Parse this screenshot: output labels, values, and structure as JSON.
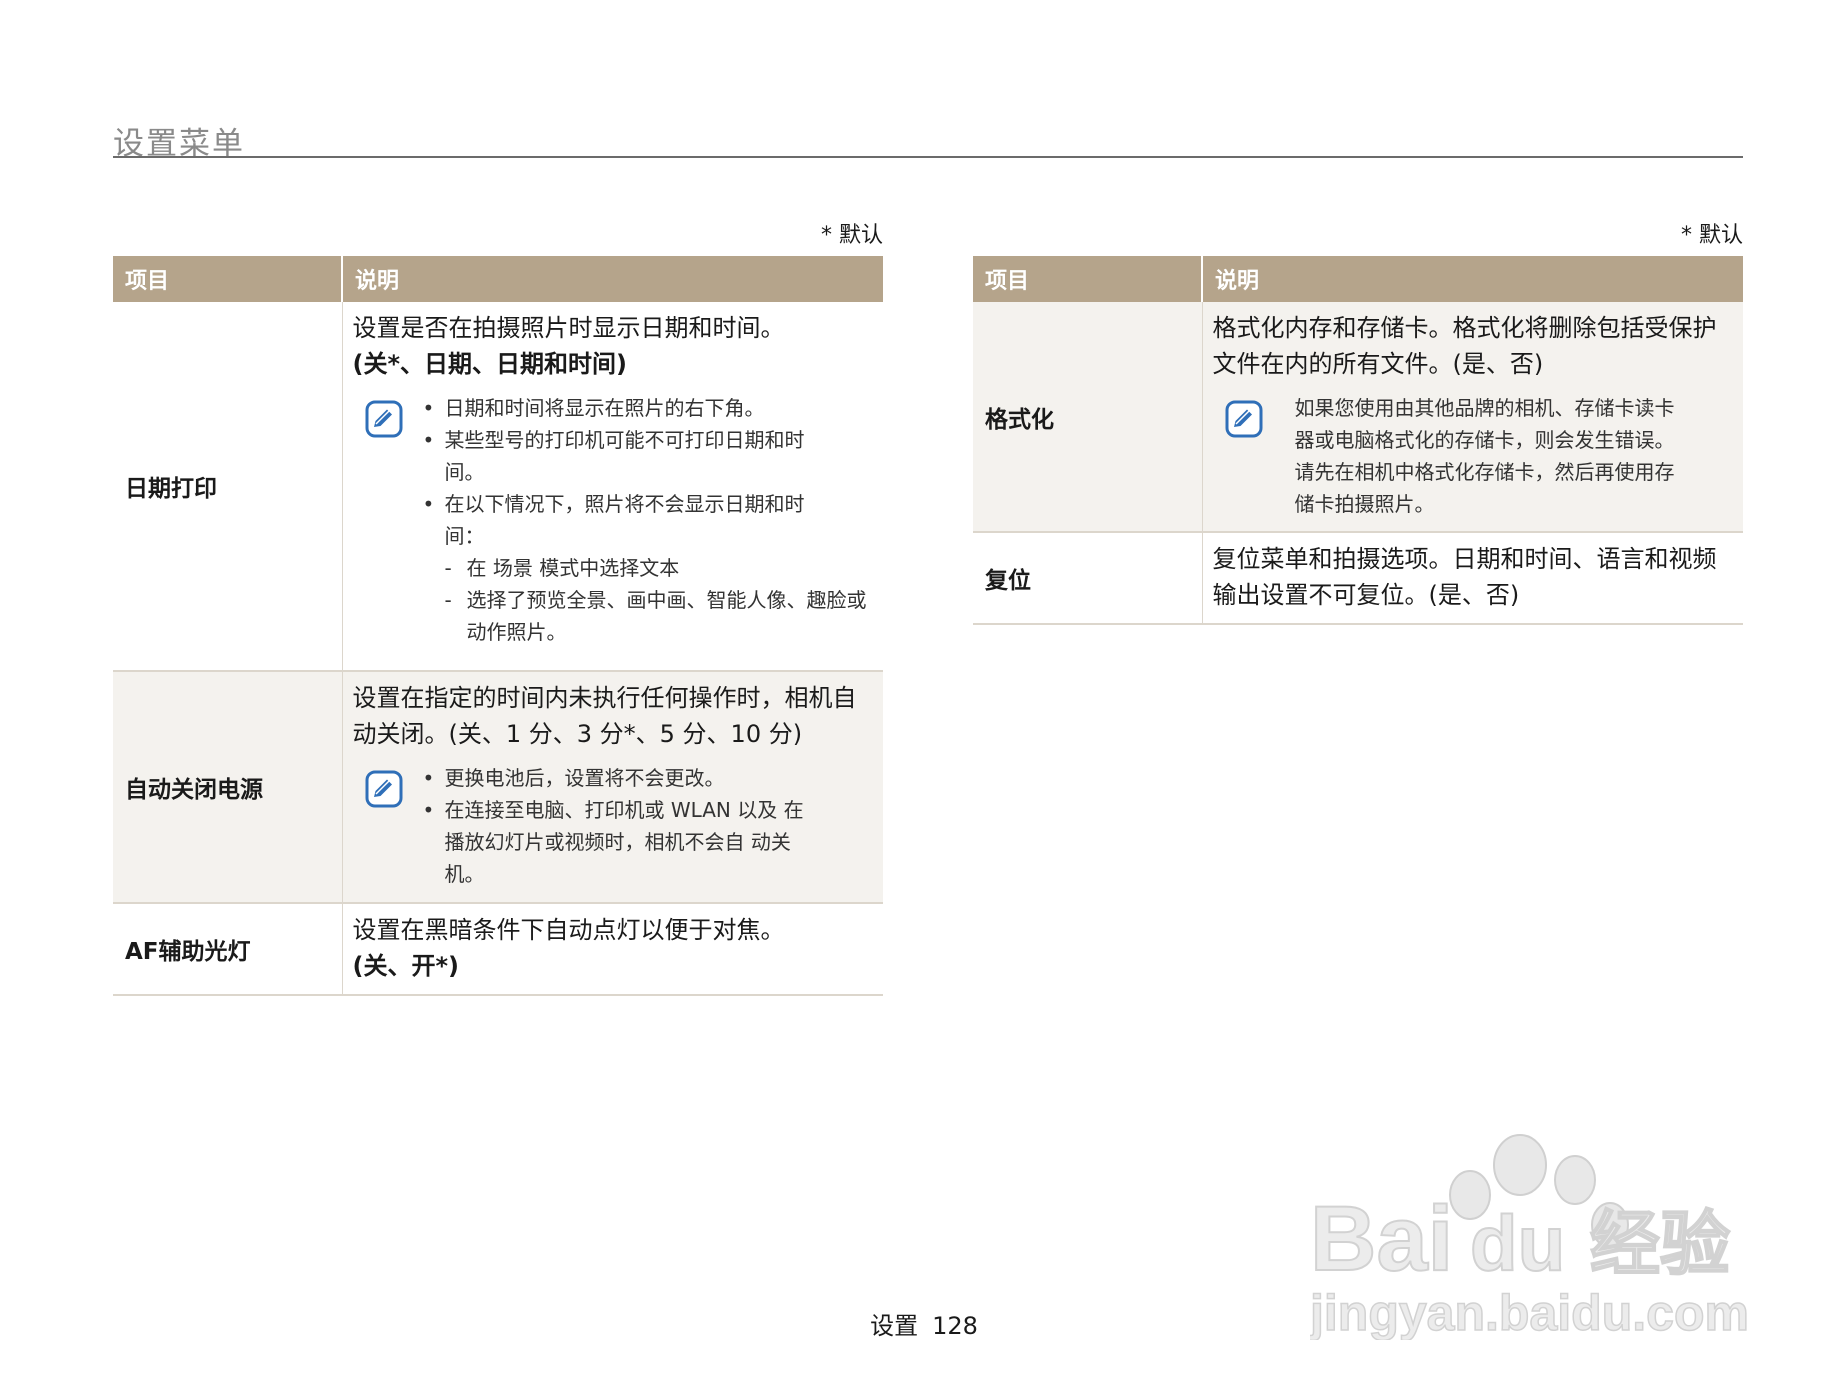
{
  "page_title": "设置菜单",
  "default_note": "* 默认",
  "table_headers": {
    "item": "项目",
    "desc": "说明"
  },
  "left_rows": [
    {
      "item": "日期打印",
      "line1": "设置是否在拍摄照片时显示日期和时间。",
      "line2": "(关*、日期、日期和时间)",
      "note_line1": "日期和时间将显示在照片的右下角。",
      "note_line2": "某些型号的打印机可能不可打印日期和时间。",
      "note_line3": "在以下情况下，照片将不会显示日期和时间：",
      "note_line4": "在 场景 模式中选择文本",
      "note_line5": "选择了预览全景、画中画、智能人像、趣脸或动作照片。"
    },
    {
      "item": "自动关闭电源",
      "line1": "设置在指定的时间内未执行任何操作时，相机自动关闭。(关、1 分、3 分*、5 分、10 分)",
      "note_line1": "更换电池后，设置将不会更改。",
      "note_line2": "在连接至电脑、打印机或 WLAN 以及 在播放幻灯片或视频时，相机不会自 动关机。"
    },
    {
      "item": "AF辅助光灯",
      "line1": "设置在黑暗条件下自动点灯以便于对焦。",
      "line2": "(关、开*)"
    }
  ],
  "right_rows": [
    {
      "item": "格式化",
      "line1": "格式化内存和存储卡。格式化将删除包括受保护文件在内的所有文件。(是、否)",
      "note_line1": "如果您使用由其他品牌的相机、存储卡读卡器或电脑格式化的存储卡，则会发生错误。请先在相机中格式化存储卡，然后再使用存储卡拍摄照片。"
    },
    {
      "item": "复位",
      "line1": "复位菜单和拍摄选项。日期和时间、语言和视频输出设置不可复位。(是、否)"
    }
  ],
  "footer": {
    "section": "设置",
    "page": "128"
  },
  "watermark": {
    "brand": "Bai",
    "brand2": "du",
    "cn": "经验",
    "url": "jingyan.baidu.com"
  },
  "colors": {
    "header_bg": "#b5a48b",
    "shade_bg": "#f4f2ee",
    "icon_blue": "#2f6fb8",
    "title_gray": "#8a8a8a"
  }
}
